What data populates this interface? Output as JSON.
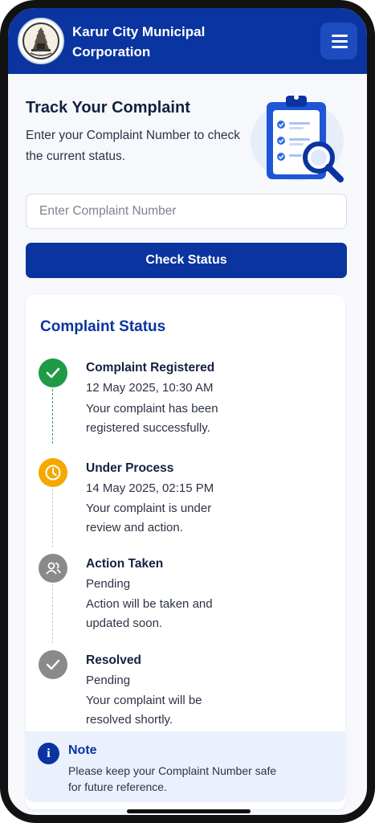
{
  "header": {
    "title": "Karur City Municipal Corporation",
    "logo_icon": "temple-emblem-icon",
    "menu_icon": "hamburger-menu-icon"
  },
  "intro": {
    "title": "Track Your Complaint",
    "description": "Enter your Complaint Number to check the current status.",
    "illustration_icon": "clipboard-search-icon"
  },
  "form": {
    "input_placeholder": "Enter Complaint Number",
    "input_value": "",
    "button_label": "Check Status"
  },
  "status": {
    "title": "Complaint Status",
    "steps": [
      {
        "name": "Complaint Registered",
        "date": "12 May 2025, 10:30 AM",
        "description": "Your complaint has been registered successfully.",
        "icon": "check-icon",
        "color": "#1f9a46",
        "state": "done"
      },
      {
        "name": "Under Process",
        "date": "14 May 2025, 02:15 PM",
        "description": "Your complaint is under review and action.",
        "icon": "clock-icon",
        "color": "#f5a800",
        "state": "active"
      },
      {
        "name": "Action Taken",
        "date": "Pending",
        "description": "Action will be taken and updated soon.",
        "icon": "user-group-icon",
        "color": "#8a8a8a",
        "state": "pending"
      },
      {
        "name": "Resolved",
        "date": "Pending",
        "description": "Your complaint will be resolved shortly.",
        "icon": "check-icon",
        "color": "#8a8a8a",
        "state": "pending"
      }
    ]
  },
  "note": {
    "title": "Note",
    "text": "Please keep your Complaint Number safe for future reference.",
    "icon": "info-icon"
  },
  "colors": {
    "primary": "#0a34a0",
    "success": "#1f9a46",
    "warning": "#f5a800",
    "pending": "#8a8a8a"
  }
}
